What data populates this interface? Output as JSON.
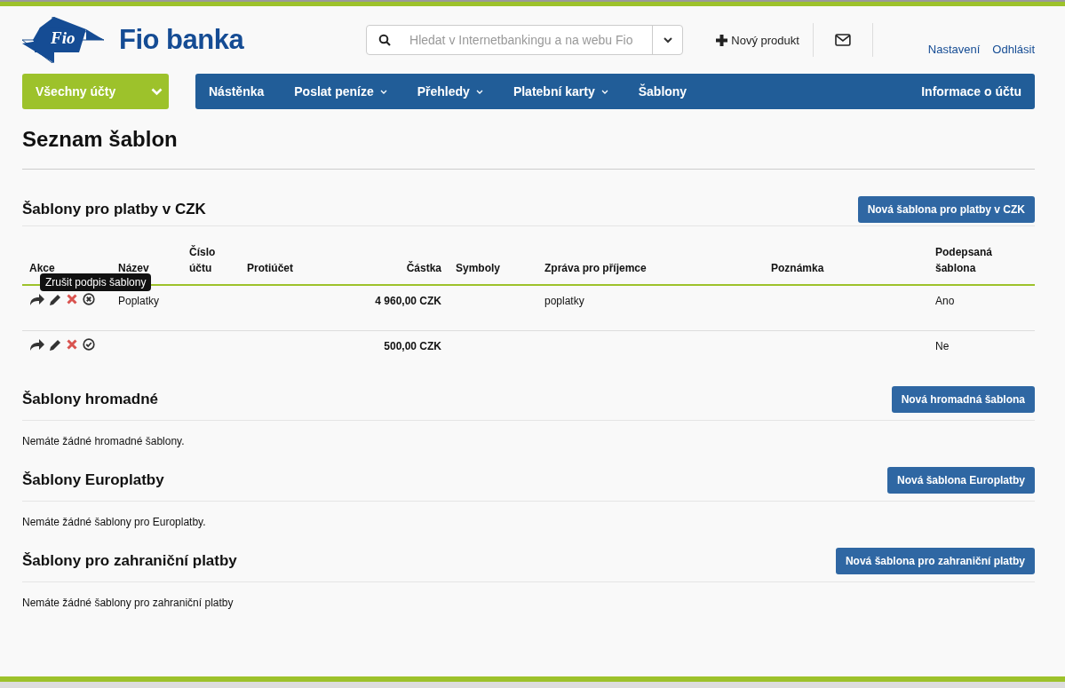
{
  "header": {
    "logo_badge": "Fio",
    "logo_text": "Fio banka",
    "search": {
      "placeholder": "Hledat v Internetbankingu a na webu Fio"
    },
    "new_product": "Nový produkt",
    "links": [
      "Nastavení",
      "Odhlásit"
    ]
  },
  "account_select": "Všechny účty",
  "nav": [
    {
      "label": "Nástěnka",
      "dropdown": false
    },
    {
      "label": "Poslat peníze",
      "dropdown": true
    },
    {
      "label": "Přehledy",
      "dropdown": true
    },
    {
      "label": "Platební karty",
      "dropdown": true
    },
    {
      "label": "Šablony",
      "dropdown": false
    }
  ],
  "nav_right": "Informace o účtu",
  "page_title": "Seznam šablon",
  "czk": {
    "title": "Šablony pro platby v CZK",
    "button": "Nová šablona pro platby v CZK",
    "columns": [
      "Akce",
      "Název",
      "Číslo účtu",
      "Protiúčet",
      "Částka",
      "Symboly",
      "Zpráva pro příjemce",
      "Poznámka",
      "Podepsaná šablona"
    ],
    "rows": [
      {
        "name": "Poplatky",
        "amount": "4 960,00 CZK",
        "message": "poplatky",
        "signed": true,
        "signed_text": "Ano"
      },
      {
        "name": "",
        "amount": "500,00 CZK",
        "message": "",
        "signed": false,
        "signed_text": "Ne"
      }
    ],
    "tooltip": "Zrušit podpis šablony"
  },
  "sections": [
    {
      "title": "Šablony hromadné",
      "button": "Nová hromadná šablona",
      "empty": "Nemáte žádné hromadné šablony."
    },
    {
      "title": "Šablony Europlatby",
      "button": "Nová šablona Europlatby",
      "empty": "Nemáte žádné šablony pro Europlatby."
    },
    {
      "title": "Šablony pro zahraniční platby",
      "button": "Nová šablona pro zahraniční platby",
      "empty": "Nemáte žádné šablony pro zahraniční platby"
    }
  ]
}
